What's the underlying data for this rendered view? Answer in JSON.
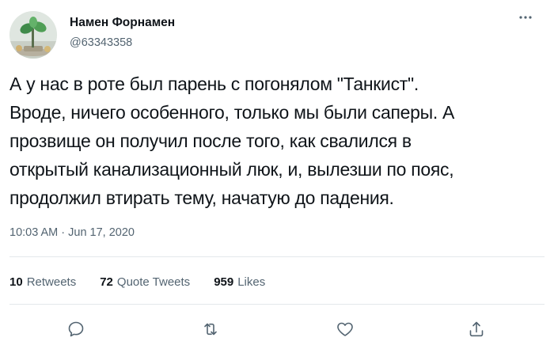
{
  "tweet": {
    "author": {
      "display_name": "Намен Форнамен",
      "handle": "@63343358"
    },
    "text_lines": [
      "А у нас в роте был парень с погонялом \"Танкист\".",
      "Вроде, ничего особенного, только мы были саперы. А",
      "прозвище он получил после того, как свалился в",
      "открытый канализационный люк, и, вылезши по пояс,",
      "продолжил втирать тему, начатую до падения."
    ],
    "timestamp": "10:03 AM · Jun 17, 2020",
    "stats": {
      "retweets_count": "10",
      "retweets_label": "Retweets",
      "quote_tweets_count": "72",
      "quote_tweets_label": "Quote Tweets",
      "likes_count": "959",
      "likes_label": "Likes"
    },
    "actions": {
      "reply_icon": "reply-icon",
      "retweet_icon": "retweet-icon",
      "like_icon": "heart-icon",
      "share_icon": "share-icon"
    }
  },
  "colors": {
    "text_primary": "#0f1419",
    "text_secondary": "#536471",
    "divider": "#e4e8eb"
  }
}
